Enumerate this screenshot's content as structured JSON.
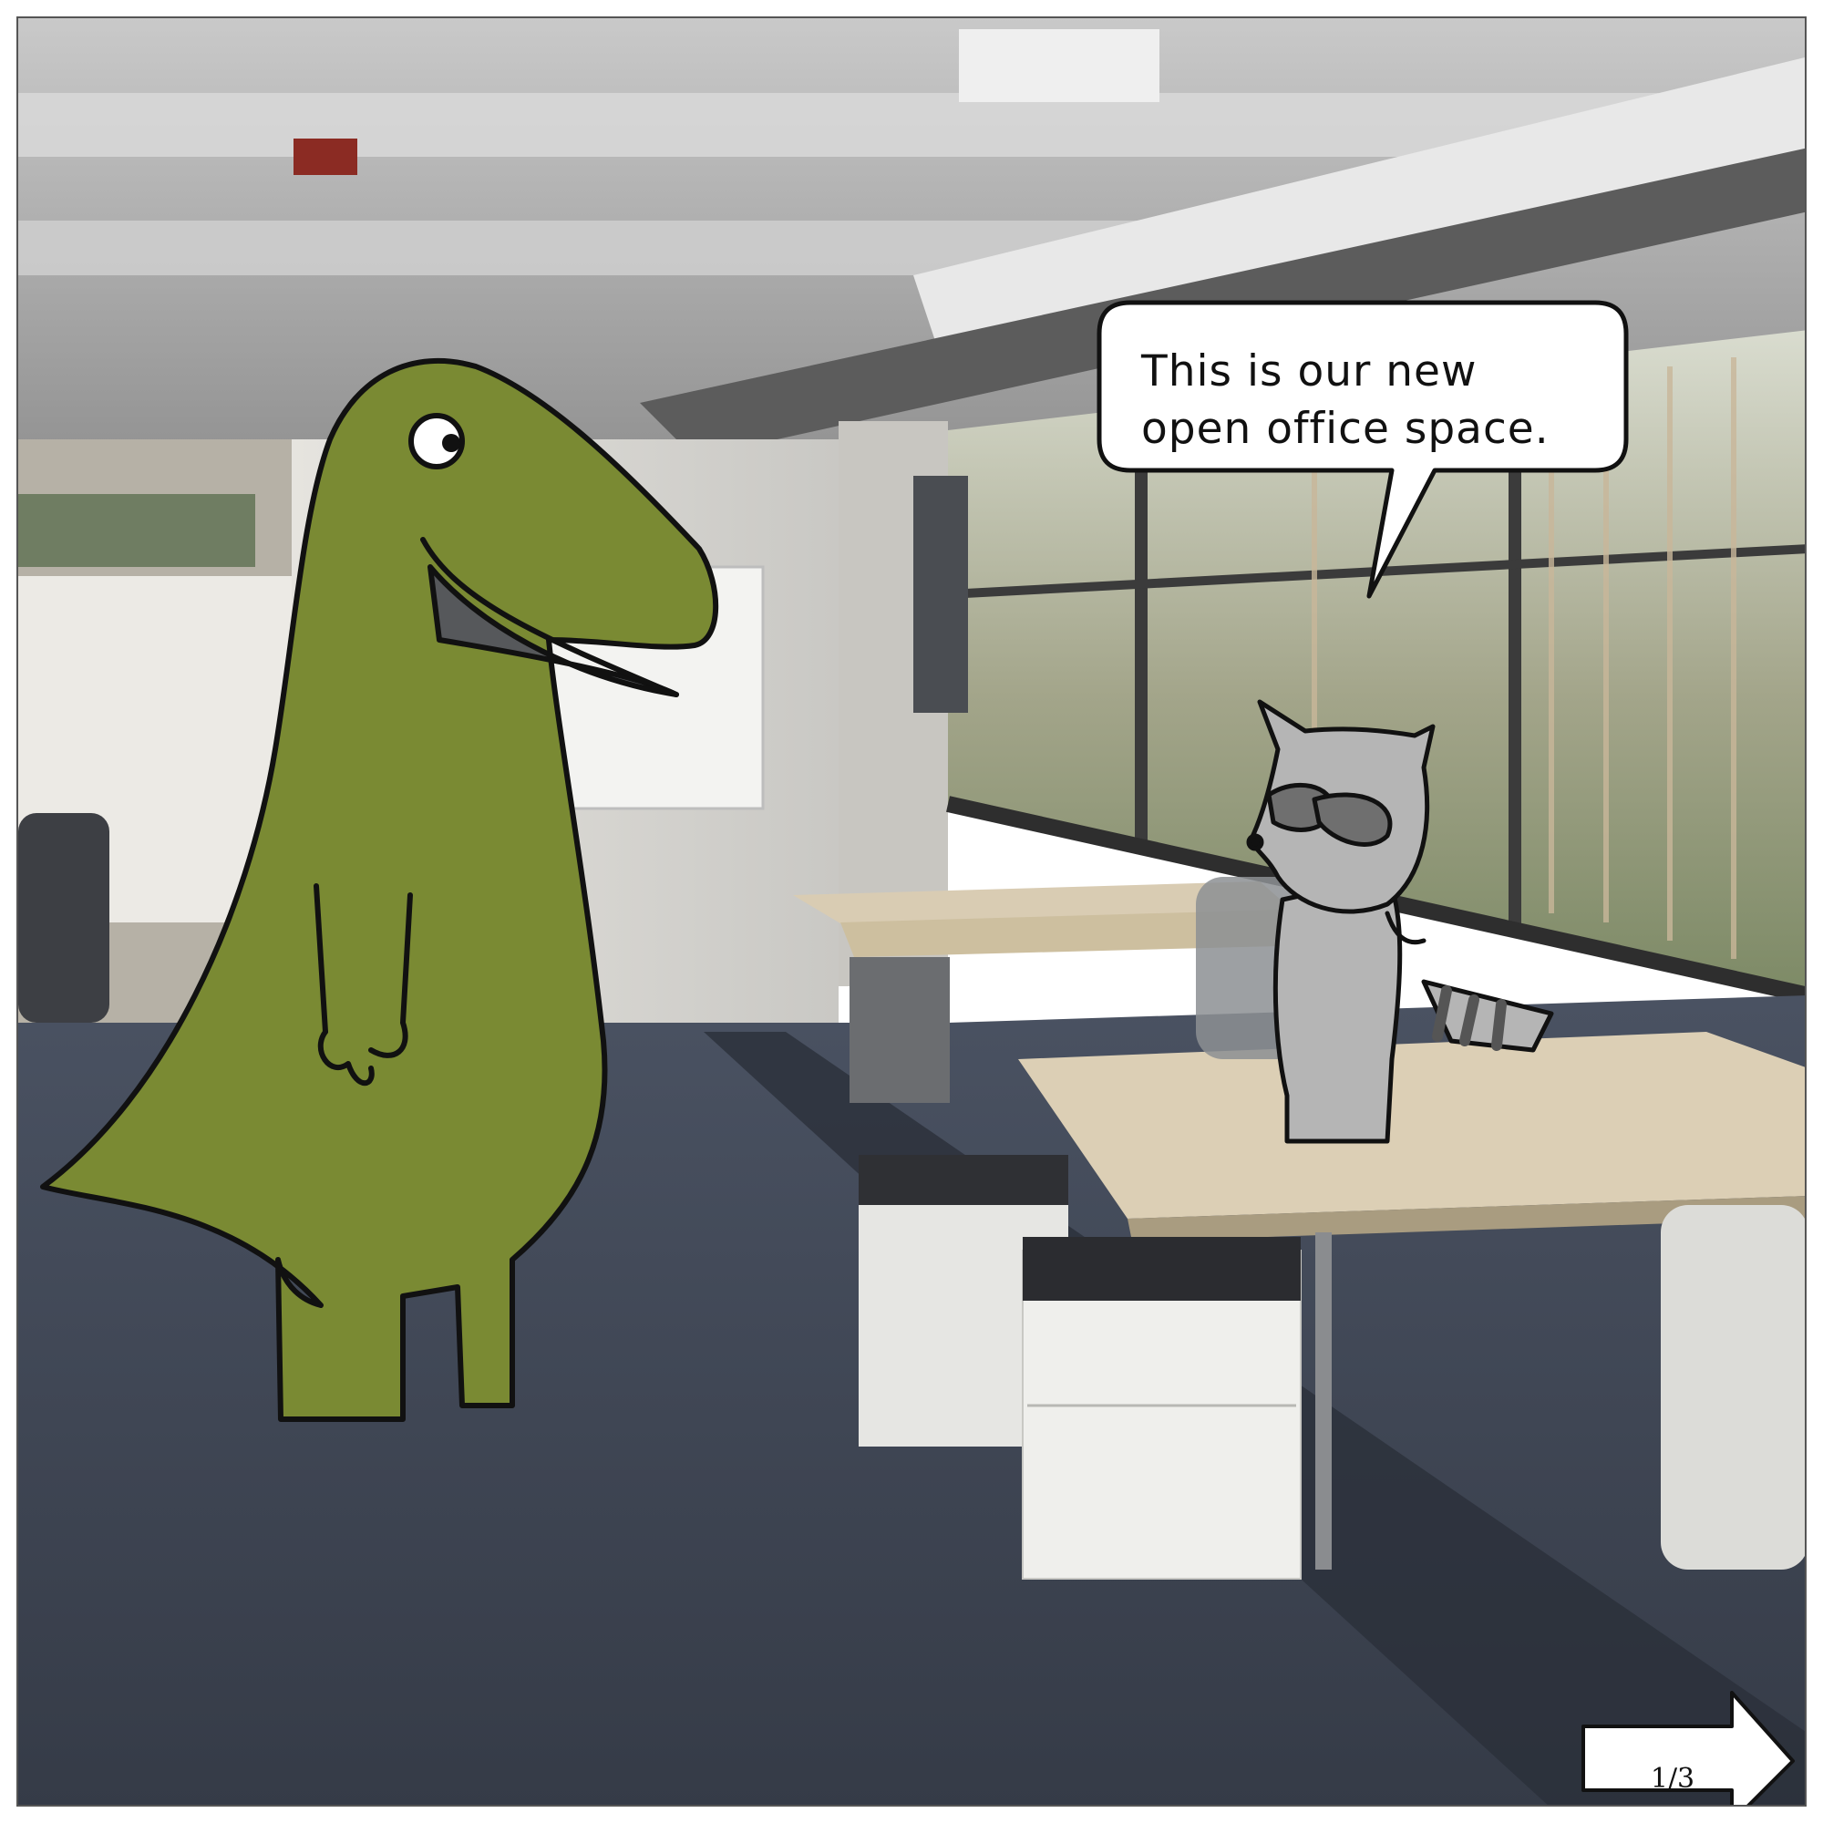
{
  "speech_bubble": {
    "line1": "This is our new",
    "line2": "open office space."
  },
  "navigation": {
    "page_counter": "1/3",
    "next_icon": "right-arrow-icon"
  },
  "colors": {
    "dinosaur_green": "#7a8a33",
    "raccoon_gray": "#b5b5b5",
    "raccoon_mask": "#6f6f6f",
    "floor_carpet": "#3e4552",
    "outline": "#111111"
  }
}
